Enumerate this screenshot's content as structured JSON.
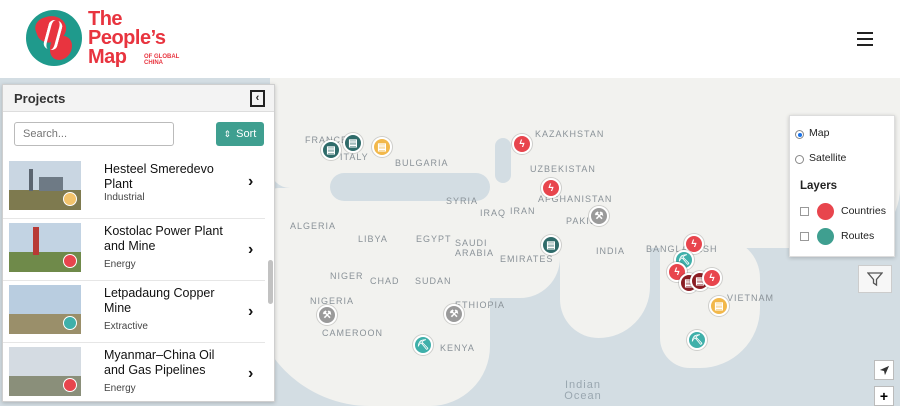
{
  "header": {
    "logo_line1": "The",
    "logo_line2": "People’s",
    "logo_line3": "Map",
    "logo_sub1": "OF GLOBAL",
    "logo_sub2": "CHINA"
  },
  "map_labels": {
    "france": "FRANCE",
    "italy": "ITALY",
    "bulgaria": "BULGARIA",
    "kazakhstan": "KAZAKHSTAN",
    "uzbekistan": "UZBEKISTAN",
    "afghanistan": "AFGHANISTAN",
    "pakistan": "PAKIS",
    "iran": "IRAN",
    "iraq": "IRAQ",
    "syria": "SYRIA",
    "saudi": "SAUDI ARABIA",
    "emirates": "EMIRATES",
    "egypt": "EGYPT",
    "libya": "LIBYA",
    "algeria": "ALGERIA",
    "niger": "NIGER",
    "chad": "CHAD",
    "sudan": "SUDAN",
    "ethiopia": "ETHIOPIA",
    "kenya": "KENYA",
    "cameroon": "CAMEROON",
    "nigeria": "NIGERIA",
    "bangladesh": "BANGLADESH",
    "vietnam": "VIETNAM",
    "india": "INDIA",
    "indian_ocean_1": "Indian",
    "indian_ocean_2": "Ocean"
  },
  "panel": {
    "title": "Projects",
    "search_placeholder": "Search...",
    "sort_label": "Sort",
    "sort_icon": "updown-arrows-icon",
    "collapse_icon": "collapse-left-icon",
    "items": [
      {
        "title": "Hesteel Smeredevo Plant",
        "category": "Industrial",
        "badge_color": "#f2c36b",
        "thumb": "steel-plant-photo"
      },
      {
        "title": "Kostolac Power Plant and Mine",
        "category": "Energy",
        "badge_color": "#e8454d",
        "thumb": "power-plant-photo"
      },
      {
        "title": "Letpadaung Copper Mine",
        "category": "Extractive",
        "badge_color": "#3fb0aa",
        "thumb": "mine-photo"
      },
      {
        "title": "Myanmar–China Oil and Gas Pipelines",
        "category": "Energy",
        "badge_color": "#e8454d",
        "thumb": "pipeline-photo"
      }
    ]
  },
  "layers": {
    "map_option": "Map",
    "satellite_option": "Satellite",
    "selected_base": "Map",
    "heading": "Layers",
    "countries": "Countries",
    "routes": "Routes",
    "countries_color": "#e8454d",
    "routes_color": "#3f9f90"
  },
  "controls": {
    "filter_icon": "filter-funnel-icon",
    "locate_icon": "locate-arrow-icon",
    "zoom_in": "+"
  },
  "colors": {
    "brand_red": "#e8343f",
    "brand_teal": "#1f9a8c",
    "energy": "#e8454d",
    "industrial": "#f2b84b",
    "extractive": "#3fb0aa",
    "manufacturing": "#2f6b6a",
    "other": "#9a9a9a"
  }
}
